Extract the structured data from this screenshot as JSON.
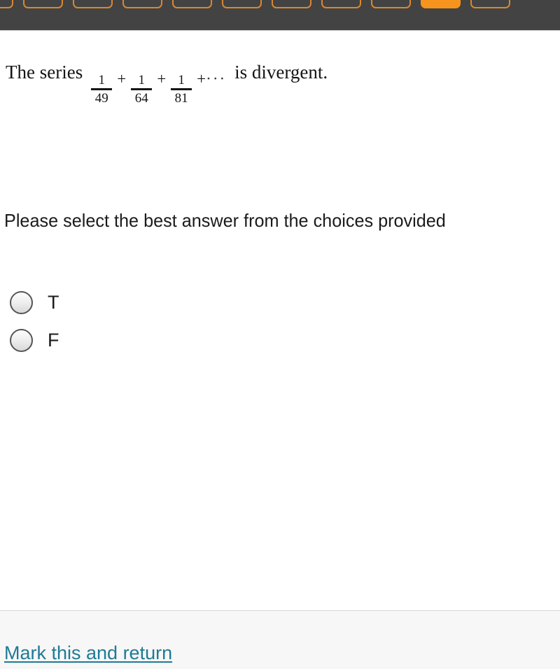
{
  "tabbar": {
    "background_color": "#434343",
    "tab_outline_color": "#d98731",
    "tab_selected_color": "#f7941e",
    "tabs": [
      {
        "name": "tab-1",
        "selected": false
      },
      {
        "name": "tab-2",
        "selected": false
      },
      {
        "name": "tab-3",
        "selected": false
      },
      {
        "name": "tab-4",
        "selected": false
      },
      {
        "name": "tab-5",
        "selected": false
      },
      {
        "name": "tab-6",
        "selected": false
      },
      {
        "name": "tab-7",
        "selected": false
      },
      {
        "name": "tab-8",
        "selected": false
      },
      {
        "name": "tab-9",
        "selected": false
      },
      {
        "name": "tab-10",
        "selected": true
      },
      {
        "name": "tab-11",
        "selected": false
      }
    ]
  },
  "question": {
    "lead_text": "The series",
    "fractions": [
      {
        "numerator": "1",
        "denominator": "49"
      },
      {
        "numerator": "1",
        "denominator": "64"
      },
      {
        "numerator": "1",
        "denominator": "81"
      }
    ],
    "plus_1": "+",
    "plus_2": "+",
    "plus_3": "+",
    "ellipsis": "···",
    "tail_text": "is divergent."
  },
  "instruction": {
    "text": "Please select the best answer from the choices provided"
  },
  "choices": {
    "options": [
      {
        "label": "T",
        "selected": false
      },
      {
        "label": "F",
        "selected": false
      }
    ]
  },
  "footer": {
    "link_text": "Mark this and return",
    "link_color": "#1f7a96"
  }
}
